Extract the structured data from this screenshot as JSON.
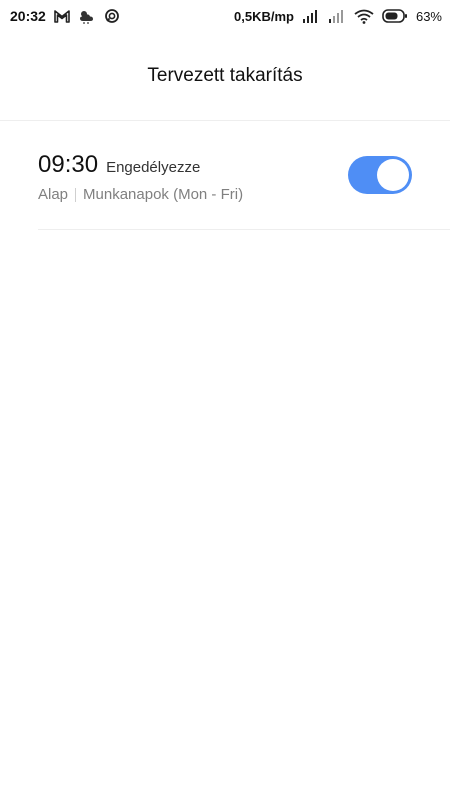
{
  "status_bar": {
    "time": "20:32",
    "icons_left": [
      "gmail-icon",
      "weather-icon",
      "sync-icon"
    ],
    "network_speed": "0,5KB/mp",
    "icons_right": [
      "signal-icon",
      "signal-icon-2",
      "wifi-icon",
      "battery-icon"
    ],
    "battery_percent": "63%"
  },
  "header": {
    "title": "Tervezett takarítás"
  },
  "schedule": {
    "time": "09:30",
    "status_label": "Engedélyezze",
    "mode": "Alap",
    "days": "Munkanapok (Mon - Fri)",
    "enabled": true
  },
  "colors": {
    "toggle_on": "#4f8ef5",
    "divider": "#eeeeee",
    "secondary_text": "#808080"
  }
}
